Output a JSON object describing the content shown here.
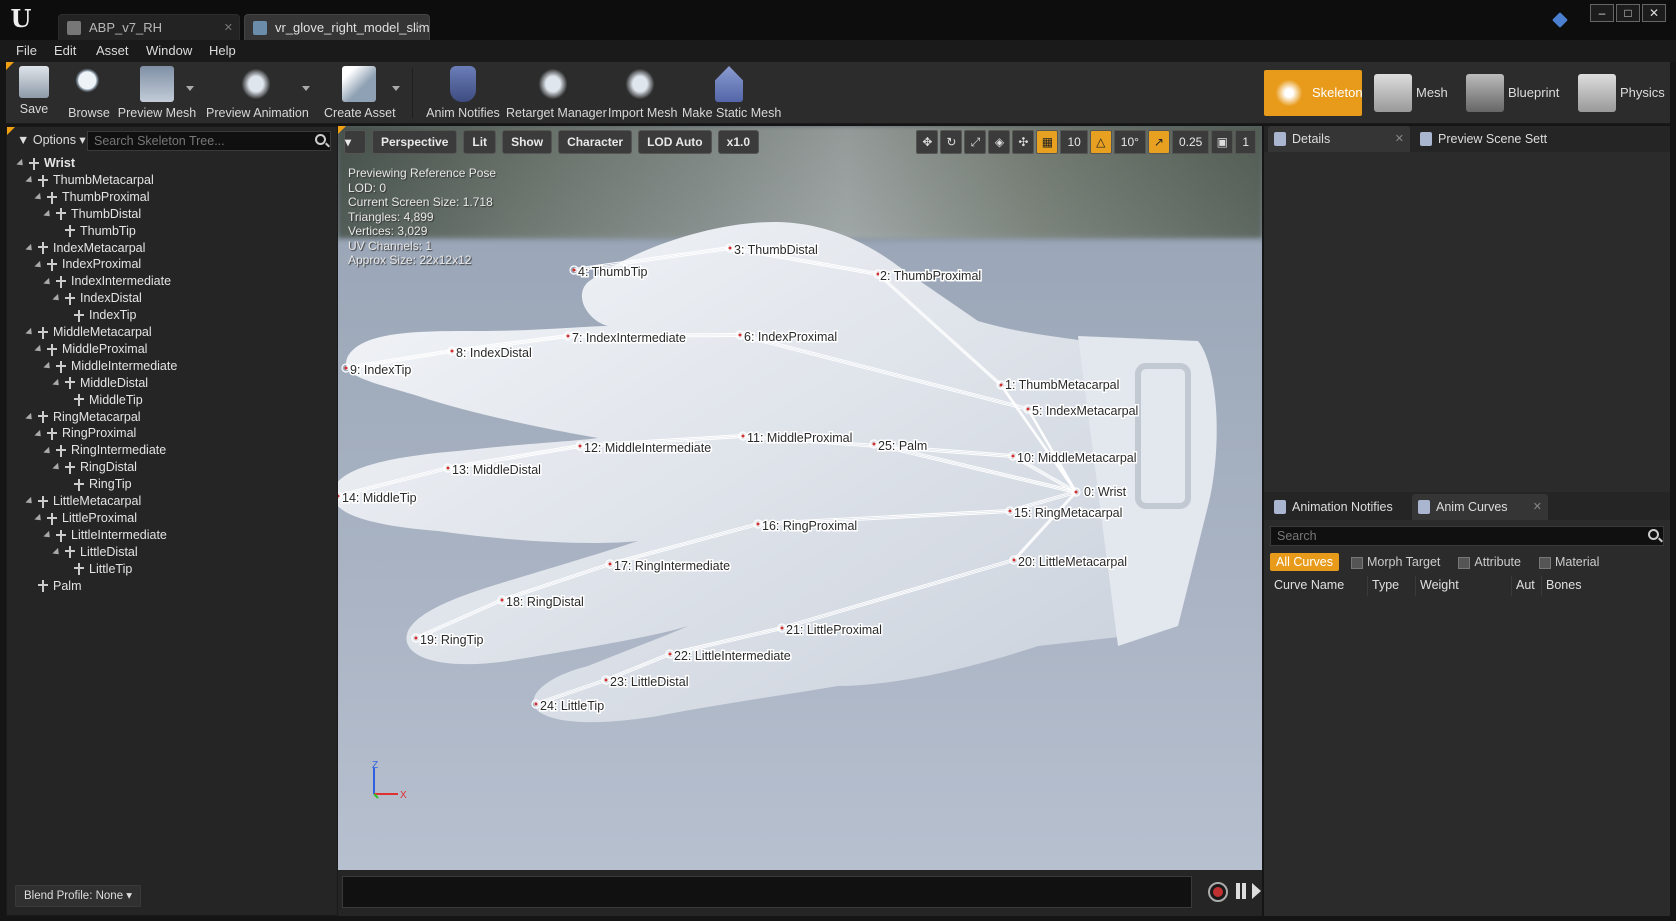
{
  "tabs": [
    {
      "label": "ABP_v7_RH"
    },
    {
      "label": "vr_glove_right_model_slim"
    }
  ],
  "window_buttons": {
    "minimize": "–",
    "maximize": "□",
    "close": "✕"
  },
  "menu": [
    "File",
    "Edit",
    "Asset",
    "Window",
    "Help"
  ],
  "toolbar": {
    "save": "Save",
    "browse": "Browse",
    "preview_mesh": "Preview Mesh",
    "preview_animation": "Preview Animation",
    "create_asset": "Create Asset",
    "anim_notifies": "Anim Notifies",
    "retarget_manager": "Retarget Manager",
    "import_mesh": "Import Mesh",
    "make_static_mesh": "Make Static Mesh"
  },
  "modes": {
    "skeleton": "Skeleton",
    "mesh": "Mesh",
    "blueprint": "Blueprint",
    "physics": "Physics"
  },
  "skeleton_tree": {
    "options": "Options",
    "search_placeholder": "Search Skeleton Tree...",
    "blend_profile": "Blend Profile: None",
    "bones": [
      {
        "name": "Wrist",
        "depth": 0
      },
      {
        "name": "ThumbMetacarpal",
        "depth": 1
      },
      {
        "name": "ThumbProximal",
        "depth": 2
      },
      {
        "name": "ThumbDistal",
        "depth": 3
      },
      {
        "name": "ThumbTip",
        "depth": 4
      },
      {
        "name": "IndexMetacarpal",
        "depth": 1
      },
      {
        "name": "IndexProximal",
        "depth": 2
      },
      {
        "name": "IndexIntermediate",
        "depth": 3
      },
      {
        "name": "IndexDistal",
        "depth": 4
      },
      {
        "name": "IndexTip",
        "depth": 5
      },
      {
        "name": "MiddleMetacarpal",
        "depth": 1
      },
      {
        "name": "MiddleProximal",
        "depth": 2
      },
      {
        "name": "MiddleIntermediate",
        "depth": 3
      },
      {
        "name": "MiddleDistal",
        "depth": 4
      },
      {
        "name": "MiddleTip",
        "depth": 5
      },
      {
        "name": "RingMetacarpal",
        "depth": 1
      },
      {
        "name": "RingProximal",
        "depth": 2
      },
      {
        "name": "RingIntermediate",
        "depth": 3
      },
      {
        "name": "RingDistal",
        "depth": 4
      },
      {
        "name": "RingTip",
        "depth": 5
      },
      {
        "name": "LittleMetacarpal",
        "depth": 1
      },
      {
        "name": "LittleProximal",
        "depth": 2
      },
      {
        "name": "LittleIntermediate",
        "depth": 3
      },
      {
        "name": "LittleDistal",
        "depth": 4
      },
      {
        "name": "LittleTip",
        "depth": 5
      },
      {
        "name": "Palm",
        "depth": 1
      }
    ]
  },
  "viewport": {
    "perspective": "Perspective",
    "lit": "Lit",
    "show": "Show",
    "character": "Character",
    "lod": "LOD Auto",
    "speed": "x1.0",
    "grid_snap": "10",
    "rot_snap": "10°",
    "scale_snap": "0.25",
    "cam_speed": "1",
    "info": [
      "Previewing Reference Pose",
      "LOD: 0",
      "Current Screen Size: 1.718",
      "Triangles: 4,899",
      "Vertices: 3,029",
      "UV Channels: 1",
      "Approx Size: 22x12x12"
    ],
    "axis": {
      "z": "Z",
      "x": "X"
    },
    "bone_labels": [
      "0: Wrist",
      "1: ThumbMetacarpal",
      "2: ThumbProximal",
      "3: ThumbDistal",
      "4: ThumbTip",
      "5: IndexMetacarpal",
      "6: IndexProximal",
      "7: IndexIntermediate",
      "8: IndexDistal",
      "9: IndexTip",
      "10: MiddleMetacarpal",
      "11: MiddleProximal",
      "12: MiddleIntermediate",
      "13: MiddleDistal",
      "14: MiddleTip",
      "15: RingMetacarpal",
      "16: RingProximal",
      "17: RingIntermediate",
      "18: RingDistal",
      "19: RingTip",
      "20: LittleMetacarpal",
      "21: LittleProximal",
      "22: LittleIntermediate",
      "23: LittleDistal",
      "24: LittleTip",
      "25: Palm"
    ]
  },
  "right_panel": {
    "details": "Details",
    "preview_scene": "Preview Scene Sett",
    "anim_notifications": "Animation Notifies",
    "anim_curves": "Anim Curves",
    "search": "Search",
    "filters": {
      "all": "All Curves",
      "morph": "Morph Target",
      "attribute": "Attribute",
      "material": "Material"
    },
    "columns": [
      "Curve Name",
      "Type",
      "Weight",
      "Aut",
      "Bones"
    ]
  },
  "colors": {
    "accent": "#e89a1a",
    "panel": "#252525"
  }
}
